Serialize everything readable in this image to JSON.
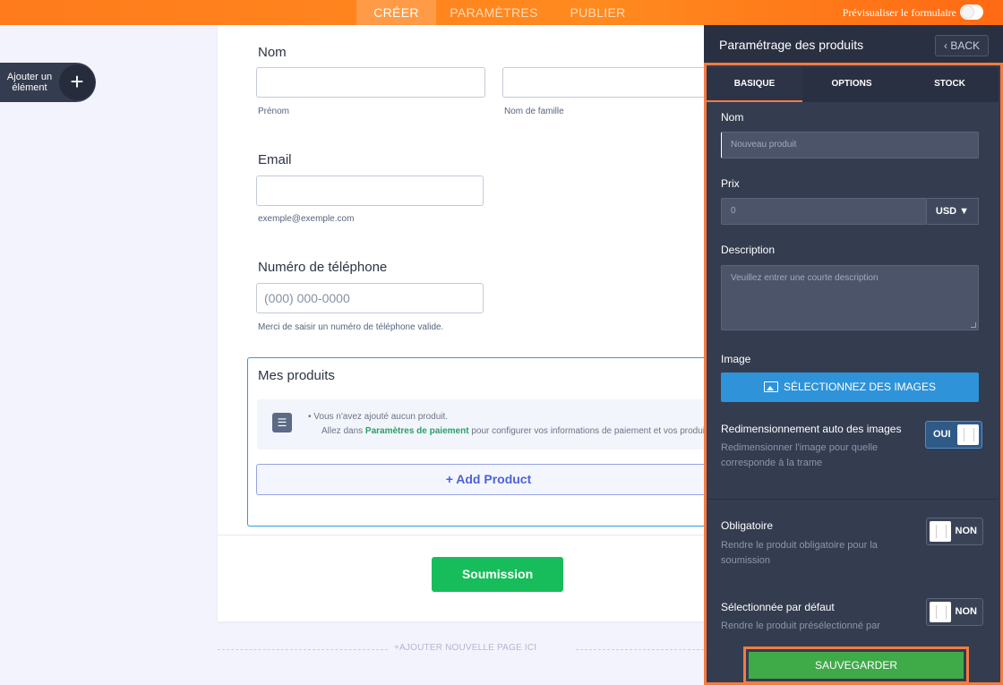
{
  "topbar": {
    "tabs": [
      {
        "label": "CRÉER",
        "active": true
      },
      {
        "label": "PARAMÈTRES",
        "active": false
      },
      {
        "label": "PUBLIER",
        "active": false
      }
    ],
    "preview_label": "Prévisualiser le formulaire"
  },
  "add_element": {
    "label": "Ajouter un élément",
    "icon": "plus-icon"
  },
  "form": {
    "name": {
      "label": "Nom",
      "first_sub": "Prénom",
      "last_sub": "Nom de famille"
    },
    "email": {
      "label": "Email",
      "sub": "exemple@exemple.com"
    },
    "phone": {
      "label": "Numéro de téléphone",
      "placeholder": "(000) 000-0000",
      "sub": "Merci de saisir un numéro de téléphone valide."
    },
    "products": {
      "title": "Mes produits",
      "empty_line1": "•  Vous n'avez ajouté aucun produit.",
      "empty_line2_pre": "Allez dans ",
      "empty_line2_link": "Paramètres de paiement",
      "empty_line2_post": " pour configurer vos informations de paiement et vos produits.",
      "add_button": "+ Add Product"
    },
    "submit_label": "Soumission",
    "add_page_label": "+AJOUTER NOUVELLE PAGE ICI"
  },
  "panel": {
    "title": "Paramétrage des produits",
    "back_label": "BACK",
    "tabs": [
      {
        "label": "BASIQUE",
        "active": true
      },
      {
        "label": "OPTIONS",
        "active": false
      },
      {
        "label": "STOCK",
        "active": false
      }
    ],
    "name_label": "Nom",
    "name_placeholder": "Nouveau produit",
    "price_label": "Prix",
    "price_placeholder": "0",
    "currency": "USD ▼",
    "description_label": "Description",
    "description_placeholder": "Veuillez entrer une courte description",
    "image_label": "Image",
    "image_button": "SÉLECTIONNEZ DES IMAGES",
    "auto_resize": {
      "label": "Redimensionnement auto des images",
      "sub": "Redimensionner l'image pour quelle corresponde à la trame",
      "state": "OUI"
    },
    "required": {
      "label": "Obligatoire",
      "sub": "Rendre le produit obligatoire pour la soumission",
      "state": "NON"
    },
    "default_selected": {
      "label": "Sélectionnée par défaut",
      "sub": "Rendre le produit présélectionné par",
      "state": "NON"
    },
    "save_label": "SAUVEGARDER"
  },
  "colors": {
    "accent": "#ff7b1c",
    "highlight": "#f47b42",
    "panel_bg": "#343c4f",
    "save_green": "#3faa48",
    "submit_green": "#18bd5b",
    "image_blue": "#2e93d8"
  }
}
